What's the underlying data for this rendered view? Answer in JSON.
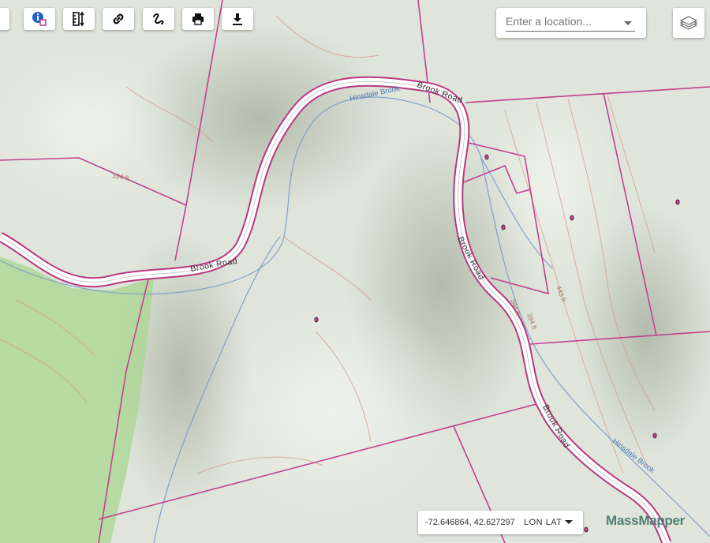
{
  "toolbar": {
    "buttons": [
      {
        "name": "info-button",
        "icon": "info-icon"
      },
      {
        "name": "identify-button",
        "icon": "info-select-icon"
      },
      {
        "name": "measure-button",
        "icon": "ruler-icon"
      },
      {
        "name": "link-button",
        "icon": "link-icon"
      },
      {
        "name": "draw-button",
        "icon": "freehand-icon"
      },
      {
        "name": "print-button",
        "icon": "print-icon"
      },
      {
        "name": "download-button",
        "icon": "download-icon"
      }
    ]
  },
  "search": {
    "placeholder": "Enter a location..."
  },
  "layers": {
    "icon": "layers-icon"
  },
  "map": {
    "roads": [
      "Brook Road",
      "Brook Road",
      "Brook Road",
      "Brook Road"
    ],
    "streams": [
      "Hinsdale Brook",
      "Hinsdale Brook"
    ],
    "contours": [
      "344 ft",
      "394 ft",
      "443 ft",
      "394 ft"
    ],
    "colors": {
      "parcel": "#c2418f",
      "road_casing": "#b9377f",
      "road_fill": "#ffffff",
      "stream": "#7fa0cc",
      "contour": "#d69a84",
      "forest": "#a9d58f"
    }
  },
  "coordinates": {
    "value": "-72.646864, 42.627297",
    "projection": "LON LAT"
  },
  "brand": "MassMapper"
}
